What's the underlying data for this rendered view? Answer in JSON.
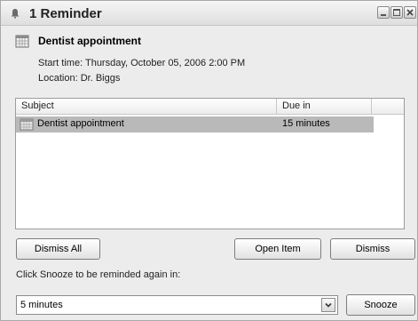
{
  "window": {
    "title": "1 Reminder",
    "title_icon": "bell-icon",
    "controls": [
      "minimize-icon",
      "maximize-icon",
      "close-icon"
    ]
  },
  "reminder": {
    "icon": "calendar-icon",
    "subject": "Dentist appointment",
    "start_time": "Start time: Thursday, October 05, 2006 2:00 PM",
    "location": "Location: Dr. Biggs"
  },
  "list": {
    "columns": [
      "Subject",
      "Due in"
    ],
    "rows": [
      {
        "icon": "calendar-icon",
        "subject": "Dentist appointment",
        "due": "15 minutes",
        "selected": true
      }
    ]
  },
  "buttons": {
    "dismiss_all": "Dismiss All",
    "open_item": "Open Item",
    "dismiss": "Dismiss",
    "snooze": "Snooze"
  },
  "snooze": {
    "prompt": "Click Snooze to be reminded again in:",
    "selected": "5 minutes"
  },
  "colors": {
    "selection": "#b9b9b9",
    "window_bg": "#ececec"
  }
}
